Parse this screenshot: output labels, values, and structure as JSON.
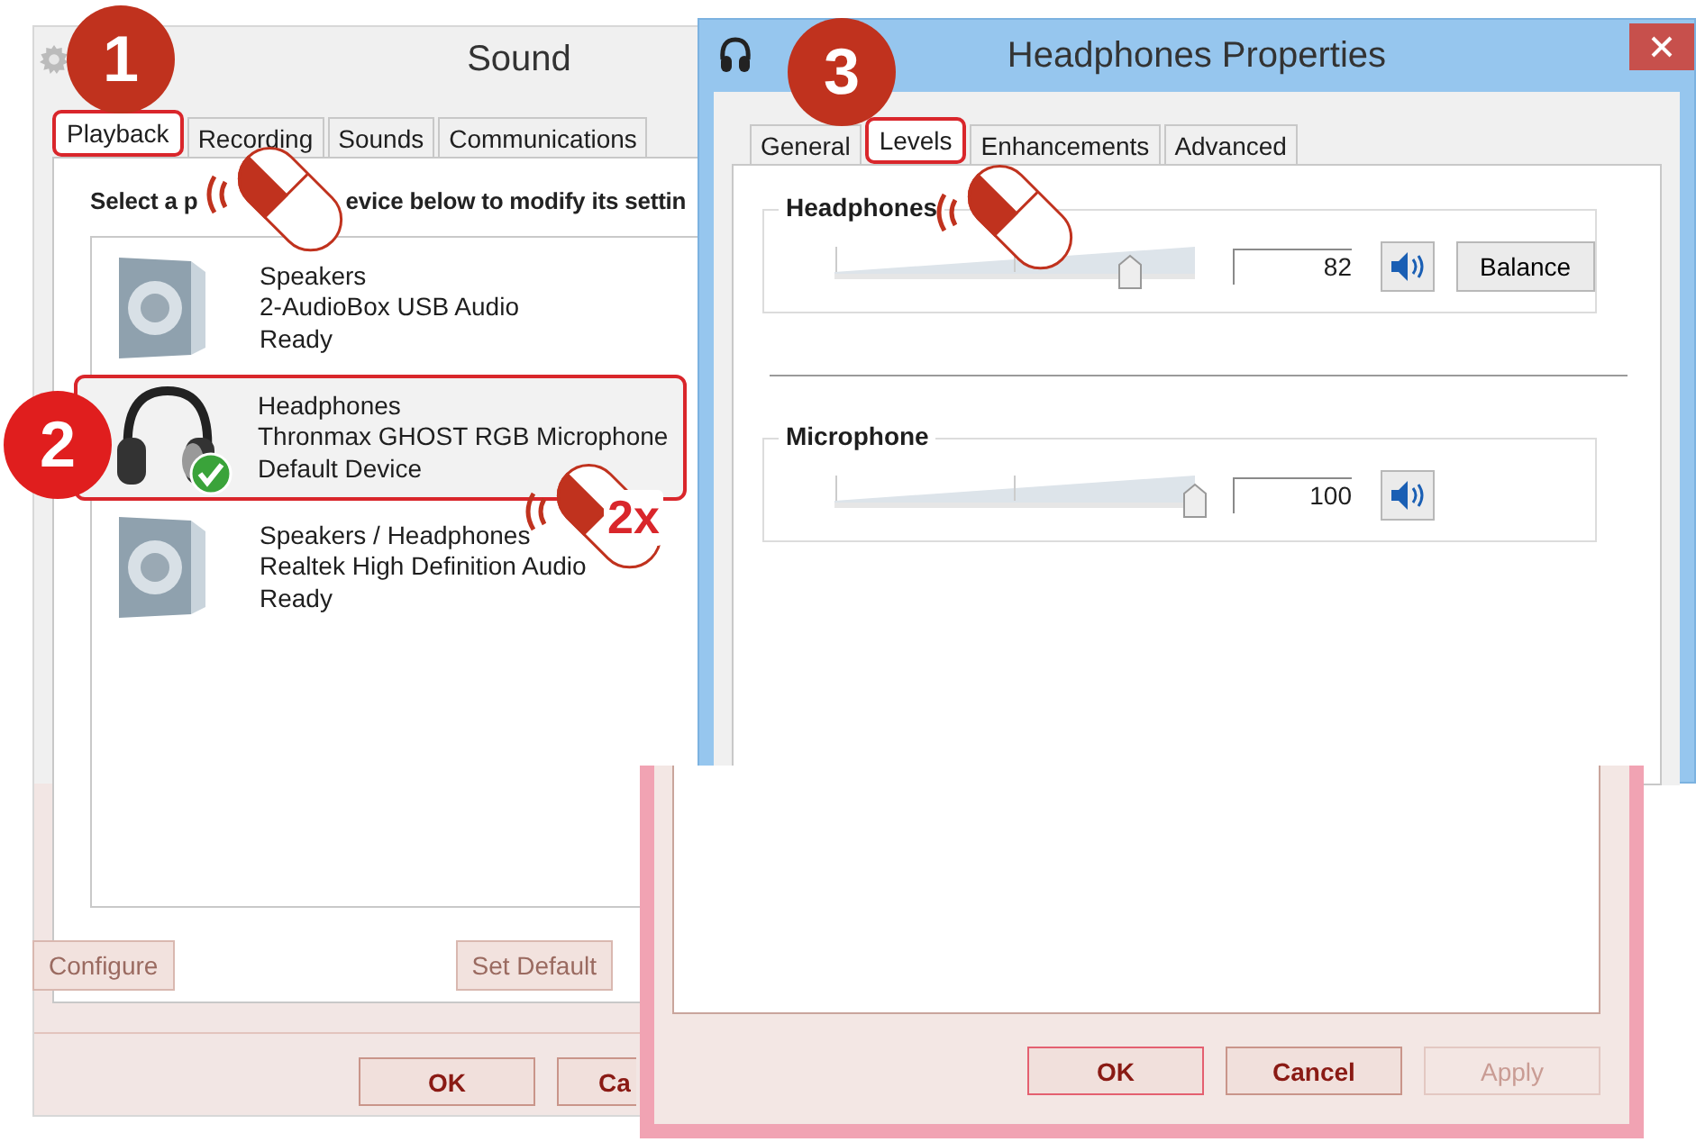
{
  "sound_window": {
    "title": "Sound",
    "tabs": [
      {
        "label": "Playback",
        "selected": true
      },
      {
        "label": "Recording",
        "selected": false
      },
      {
        "label": "Sounds",
        "selected": false
      },
      {
        "label": "Communications",
        "selected": false
      }
    ],
    "instruction": [
      "Select a p",
      "evice below to modify its settin"
    ],
    "devices": [
      {
        "kind": "speaker",
        "name": "Speakers",
        "driver": "2-AudioBox USB Audio",
        "status": "Ready",
        "selected": false,
        "is_default": false
      },
      {
        "kind": "headphones",
        "name": "Headphones",
        "driver": "Thronmax  GHOST RGB Microphone",
        "status": "Default Device",
        "selected": true,
        "is_default": true
      },
      {
        "kind": "speaker",
        "name": "Speakers / Headphones",
        "driver": "Realtek High Definition Audio",
        "status": "Ready",
        "selected": false,
        "is_default": false
      }
    ],
    "buttons": [
      {
        "label": "Configure"
      },
      {
        "label": "Set Default"
      }
    ],
    "footer_buttons": [
      {
        "label": "OK"
      },
      {
        "label": "Ca"
      }
    ]
  },
  "properties_window": {
    "title": "Headphones Properties",
    "tabs": [
      {
        "label": "General",
        "selected": false
      },
      {
        "label": "Levels",
        "selected": true
      },
      {
        "label": "Enhancements",
        "selected": false
      },
      {
        "label": "Advanced",
        "selected": false
      }
    ],
    "levels": [
      {
        "label": "Headphones",
        "level": 0.82,
        "reading": "82",
        "balance": "Balance"
      },
      {
        "label": "Microphone",
        "level": 1.0,
        "reading": "100"
      }
    ],
    "footer_buttons": [
      {
        "label": "OK",
        "disabled": false
      },
      {
        "label": "Cancel",
        "disabled": false
      },
      {
        "label": "Apply",
        "disabled": true
      }
    ]
  },
  "annotations": {
    "steps": [
      "1",
      "2",
      "3"
    ],
    "double_click": "2x"
  }
}
